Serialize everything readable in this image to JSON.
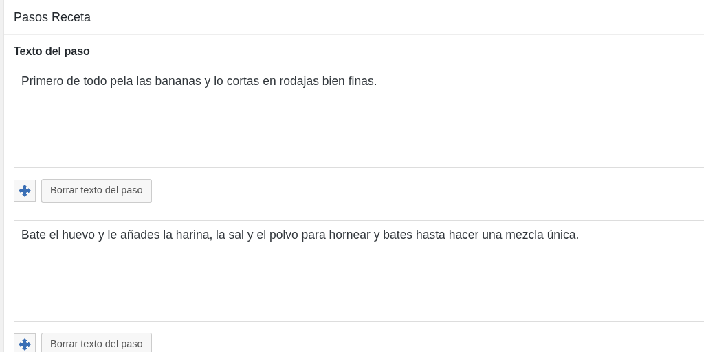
{
  "panel": {
    "title": "Pasos Receta"
  },
  "steps": [
    {
      "label": "Texto del paso",
      "value": "Primero de todo pela las bananas y lo cortas en rodajas bien finas.",
      "button": "Borrar texto del paso"
    },
    {
      "value": "Bate el huevo y le añades la harina, la sal y el polvo para hornear y bates hasta hacer una mezcla única.",
      "button": "Borrar texto del paso"
    }
  ]
}
